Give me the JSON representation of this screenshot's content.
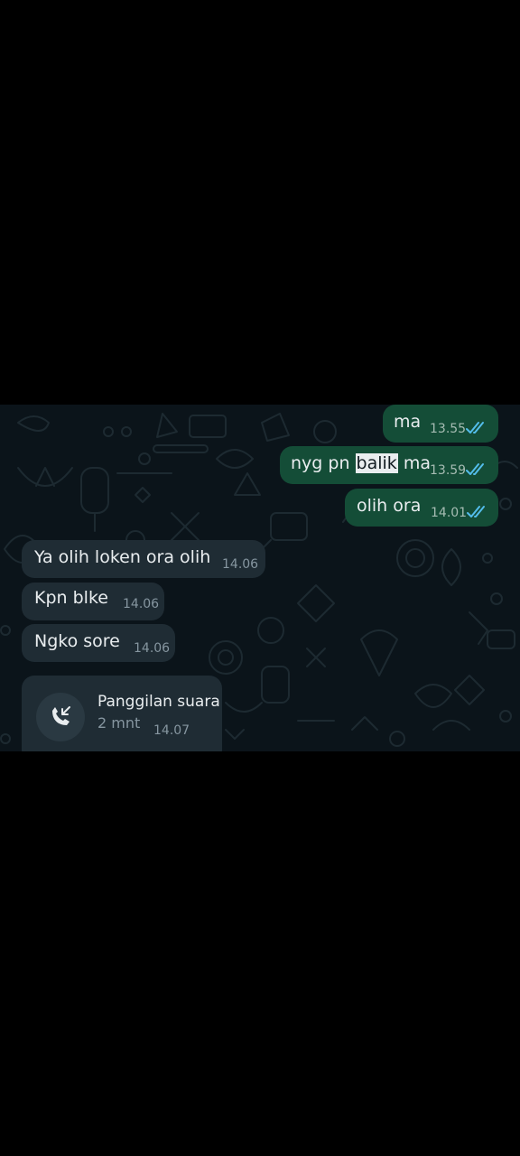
{
  "colors": {
    "chat_background": "#0b141a",
    "outgoing_bubble": "#144d37",
    "incoming_bubble": "#1f2c34",
    "read_ticks": "#53bdeb",
    "text_primary": "#e9edef",
    "text_secondary": "#8696a0"
  },
  "messages": [
    {
      "direction": "outgoing",
      "text": "ma",
      "time": "13.55",
      "status": "read",
      "status_icon": "double-check-icon"
    },
    {
      "direction": "outgoing",
      "text_before": "nyg pn",
      "text_highlight": "balik",
      "text_after": "ma",
      "time": "13.59",
      "status": "read",
      "status_icon": "double-check-icon"
    },
    {
      "direction": "outgoing",
      "text": "olih ora",
      "time": "14.01",
      "status": "read",
      "status_icon": "double-check-icon"
    },
    {
      "direction": "incoming",
      "text": "Ya olih loken ora olih",
      "time": "14.06"
    },
    {
      "direction": "incoming",
      "text": "Kpn blke",
      "time": "14.06"
    },
    {
      "direction": "incoming",
      "text": "Ngko sore",
      "time": "14.06"
    }
  ],
  "call": {
    "direction": "incoming",
    "icon": "missed-call-arrow-icon",
    "title": "Panggilan suara",
    "duration": "2 mnt",
    "time": "14.07"
  }
}
